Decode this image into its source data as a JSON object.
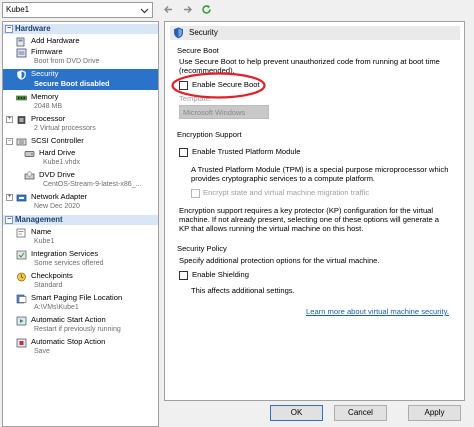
{
  "vm_selector": {
    "value": "Kube1"
  },
  "tree": {
    "hardware_header": "Hardware",
    "management_header": "Management",
    "hardware_items": [
      {
        "title": "Add Hardware",
        "sub": ""
      },
      {
        "title": "Firmware",
        "sub": "Boot from DVD Drive"
      },
      {
        "title": "Security",
        "sub": "Secure Boot disabled"
      },
      {
        "title": "Memory",
        "sub": "2048 MB"
      },
      {
        "title": "Processor",
        "sub": "2 Virtual processors"
      },
      {
        "title": "SCSI Controller",
        "sub": ""
      },
      {
        "title": "Hard Drive",
        "sub": "Kube1.vhdx"
      },
      {
        "title": "DVD Drive",
        "sub": "CentOS-Stream-9-latest-x86_..."
      },
      {
        "title": "Network Adapter",
        "sub": "New Dec 2020"
      }
    ],
    "management_items": [
      {
        "title": "Name",
        "sub": "Kube1"
      },
      {
        "title": "Integration Services",
        "sub": "Some services offered"
      },
      {
        "title": "Checkpoints",
        "sub": "Standard"
      },
      {
        "title": "Smart Paging File Location",
        "sub": "A:\\VMs\\Kube1"
      },
      {
        "title": "Automatic Start Action",
        "sub": "Restart if previously running"
      },
      {
        "title": "Automatic Stop Action",
        "sub": "Save"
      }
    ]
  },
  "panel": {
    "title": "Security",
    "secure_boot": {
      "header": "Secure Boot",
      "desc_line1": "Use Secure Boot to help prevent unauthorized code from running at boot time",
      "desc_line2": "(recommended).",
      "enable_label": "Enable Secure Boot",
      "enable_checked": false,
      "template_label": "Template:",
      "template_value": "Microsoft Windows"
    },
    "encryption": {
      "header": "Encryption Support",
      "tpm_label": "Enable Trusted Platform Module",
      "tpm_checked": false,
      "tpm_desc_line1": "A Trusted Platform Module (TPM) is a special purpose microprocessor which",
      "tpm_desc_line2": "provides cryptographic services to a compute platform.",
      "encrypt_label": "Encrypt state and virtual machine migration traffic",
      "note_line1": "Encryption support requires a key protector (KP) configuration for the virtual",
      "note_line2": "machine. If not already present, selecting one of these options will generate a",
      "note_line3": "KP that allows running the virtual machine on this host."
    },
    "policy": {
      "header": "Security Policy",
      "desc": "Specify additional protection options for the virtual machine.",
      "shielding_label": "Enable Shielding",
      "shielding_checked": false,
      "shielding_desc": "This affects additional settings."
    },
    "learn_more": "Learn more about virtual machine security."
  },
  "buttons": {
    "ok": "OK",
    "cancel": "Cancel",
    "apply": "Apply"
  },
  "colors": {
    "selection": "#2b72c9",
    "header_bg": "#d9e6f5",
    "highlight_circle": "#e0202a",
    "link": "#1a5fb4"
  }
}
